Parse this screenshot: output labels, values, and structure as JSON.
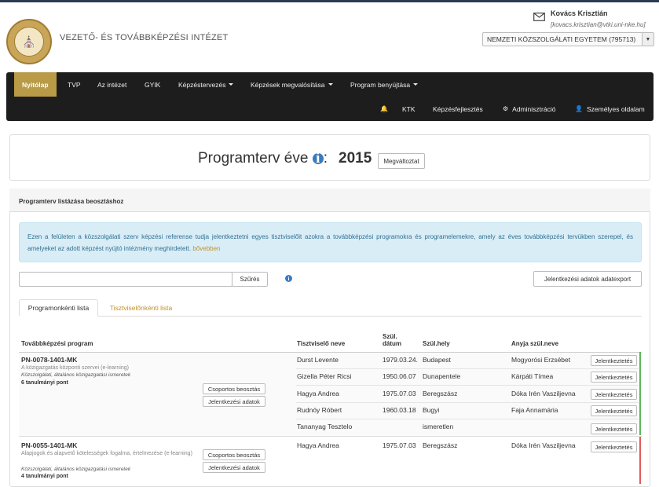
{
  "colors": {
    "navbar": "#1d1d1d",
    "accent": "#b89a47",
    "link": "#c0922d",
    "info_bg": "#d9edf7",
    "info_text": "#31708f",
    "ok": "#5cb85c",
    "warn": "#e05a5a"
  },
  "header": {
    "institute": "VEZETŐ- ÉS TOVÁBBKÉPZÉSI INTÉZET",
    "user_name": "Kovács Krisztián",
    "user_email": "[kovacs.krisztian@vtki.uni-nke.hu]",
    "org_selected": "NEMZETI KÖZSZOLGÁLATI EGYETEM (795713)",
    "icons": {
      "logo": "university-seal",
      "mail": "mail-icon"
    }
  },
  "nav": {
    "row1": [
      {
        "label": "Nyitólap",
        "active": true
      },
      {
        "label": "TVP"
      },
      {
        "label": "Az intézet"
      },
      {
        "label": "GYIK"
      },
      {
        "label": "Képzéstervezés",
        "dropdown": true
      },
      {
        "label": "Képzések megvalósítása",
        "dropdown": true
      },
      {
        "label": "Program benyújtása",
        "dropdown": true
      }
    ],
    "row2": [
      {
        "label": "",
        "icon": "bell-icon"
      },
      {
        "label": "KTK"
      },
      {
        "label": "Képzésfejlesztés"
      },
      {
        "label": "Adminisztráció",
        "icon": "gear-icon"
      },
      {
        "label": "Személyes oldalam",
        "icon": "user-icon"
      }
    ]
  },
  "year": {
    "label": "Programterv éve",
    "colon": ":",
    "value": "2015",
    "change_btn": "Megváltoztat"
  },
  "list": {
    "title": "Programterv listázása beosztáshoz",
    "alert_text": "Ezen a felületen a közszolgálati szerv képzési referense tudja jelentkeztetni egyes tisztviselőit azokra a továbbképzési programokra és programelemekre, amely az éves továbbképzési tervükben szerepel, és amelyeket az adott képzést nyújtó intézmény meghirdetett.",
    "alert_link": "bővebben",
    "filter_placeholder": "",
    "filter_btn": "Szűrés",
    "export_btn": "Jelentkezési adatok adatexport",
    "tabs": [
      "Programonkénti lista",
      "Tisztviselőnkénti lista"
    ],
    "columns": {
      "program": "Továbbképzési program",
      "name": "Tisztviselő neve",
      "dob1": "Szül.",
      "dob2": "dátum",
      "pob": "Szül.hely",
      "mother": "Anyja szül.neve"
    },
    "programs": [
      {
        "code": "PN-0078-1401-MK",
        "desc": "A közigazgatás központi szervei (e-learning)",
        "meta": "Közszolgálati, általános közigazgatási ismeretek",
        "points": "6 tanulmányi pont",
        "btn_group": "Csoportos beosztás",
        "btn_data": "Jelentkezési adatok",
        "rows": [
          {
            "name": "Durst Levente",
            "dob": "1979.03.24.",
            "pob": "Budapest",
            "mother": "Mogyorósi Erzsébet",
            "action": "Jelentkeztetés"
          },
          {
            "name": "Gizella Péter Ricsi",
            "dob": "1950.06.07",
            "pob": "Dunapentele",
            "mother": "Kárpáti Tímea",
            "action": "Jelentkeztetés"
          },
          {
            "name": "Hagya Andrea",
            "dob": "1975.07.03",
            "pob": "Beregszász",
            "mother": "Dóka Irén Vasziljevna",
            "action": "Jelentkeztetés"
          },
          {
            "name": "Rudnóy Róbert",
            "dob": "1960.03.18",
            "pob": "Bugyi",
            "mother": "Faja Annamária",
            "action": "Jelentkeztetés"
          },
          {
            "name": "Tananyag Tesztelo",
            "dob": "",
            "pob": "ismeretlen",
            "mother": "",
            "action": "Jelentkeztetés"
          }
        ]
      },
      {
        "code": "PN-0055-1401-MK",
        "desc": "Alapjogok és alapvető kötelességek fogalma, értelmezése (e-learning)",
        "meta": "Közszolgálati, általános közigazgatási ismeretek",
        "points": "4 tanulmányi pont",
        "btn_group": "Csoportos beosztás",
        "btn_data": "Jelentkezési adatok",
        "rows": [
          {
            "name": "Hagya Andrea",
            "dob": "1975.07.03",
            "pob": "Beregszász",
            "mother": "Dóka Irén Vasziljevna",
            "action": "Jelentkeztetés"
          }
        ]
      }
    ]
  }
}
